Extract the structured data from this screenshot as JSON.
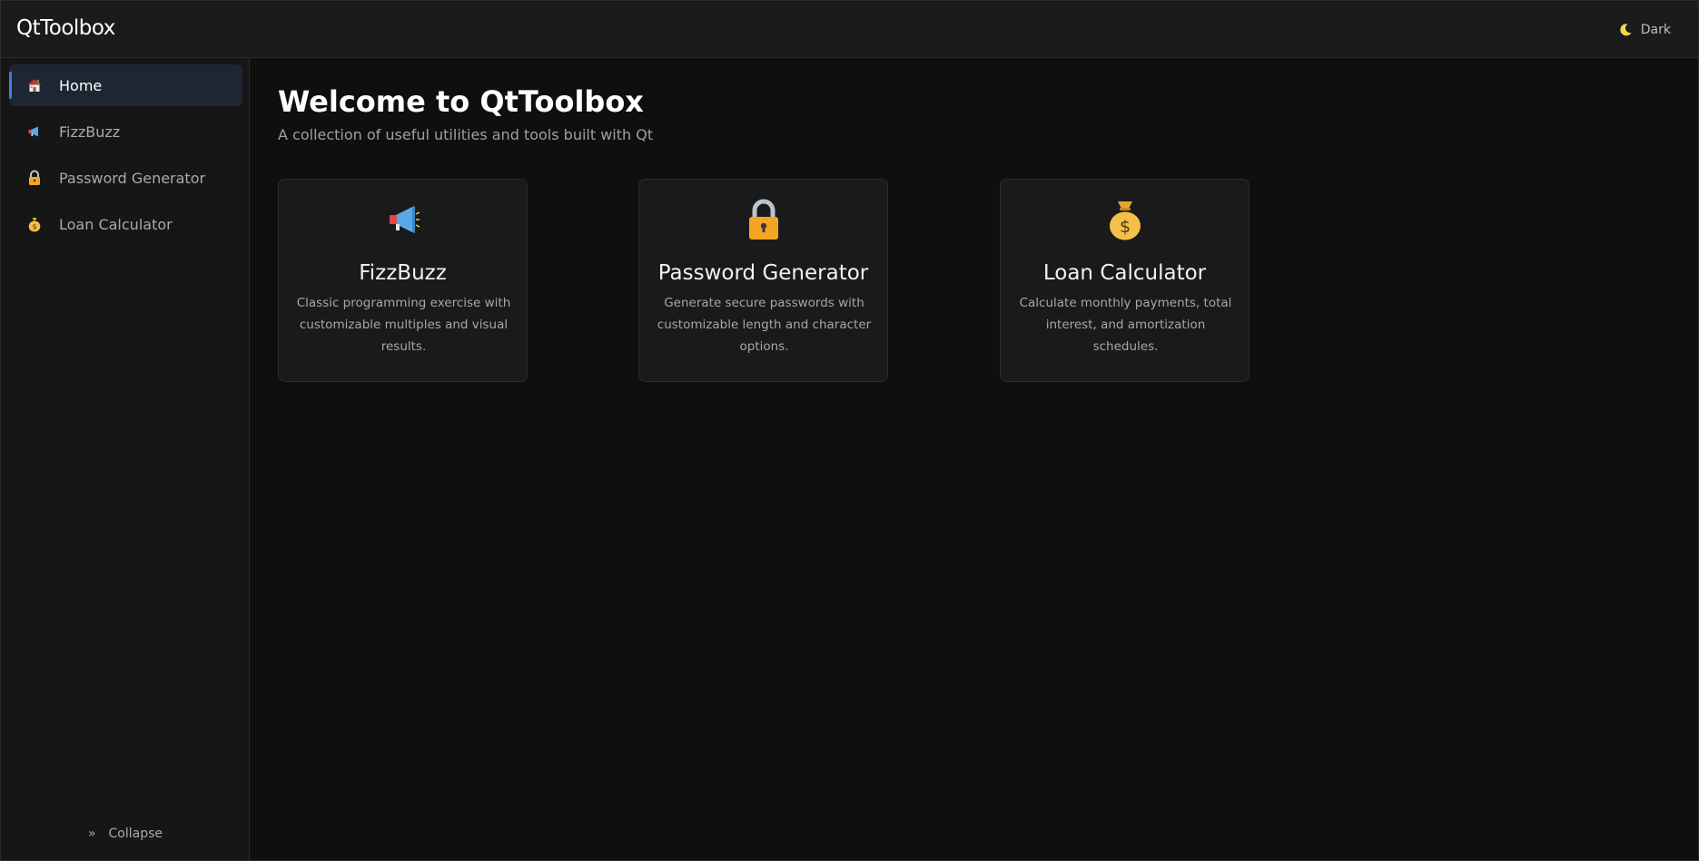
{
  "app": {
    "title": "QtToolbox"
  },
  "theme": {
    "label": "Dark",
    "icon": "moon-icon"
  },
  "sidebar": {
    "items": [
      {
        "label": "Home",
        "icon": "house-icon",
        "active": true
      },
      {
        "label": "FizzBuzz",
        "icon": "megaphone-icon",
        "active": false
      },
      {
        "label": "Password Generator",
        "icon": "lock-icon",
        "active": false
      },
      {
        "label": "Loan Calculator",
        "icon": "money-bag-icon",
        "active": false
      }
    ],
    "collapse_label": "Collapse",
    "collapse_icon": "double-chevron-right-icon"
  },
  "main": {
    "title": "Welcome to QtToolbox",
    "subtitle": "A collection of useful utilities and tools built with Qt",
    "cards": [
      {
        "title": "FizzBuzz",
        "description": "Classic programming exercise with customizable multiples and visual results.",
        "icon": "megaphone-icon"
      },
      {
        "title": "Password Generator",
        "description": "Generate secure passwords with customizable length and character options.",
        "icon": "lock-icon"
      },
      {
        "title": "Loan Calculator",
        "description": "Calculate monthly payments, total interest, and amortization schedules.",
        "icon": "money-bag-icon"
      }
    ]
  },
  "colors": {
    "accent": "#3f7de6",
    "background": "#0f0f0f",
    "sidebar": "#161616",
    "card": "#1a1a1a",
    "active_nav": "#1e2633"
  }
}
